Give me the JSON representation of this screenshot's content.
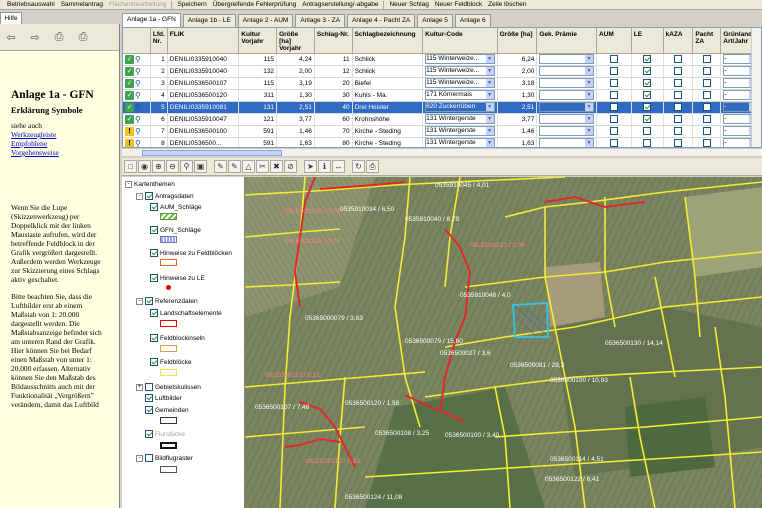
{
  "menu": {
    "items": [
      "Betriebsauswahl",
      "Sammelantrag",
      "Flächenbearbeitung",
      "Speichern",
      "Übergreifende Fehlerprüfung",
      "Antragserstellung/-abgabe",
      "Neuer Schlag",
      "Neuer Feldblock",
      "Zeile löschen"
    ]
  },
  "help": {
    "tab": "Hilfe",
    "title": "Anlage 1a - GFN",
    "subtitle": "Erklärung Symbole",
    "see_also": "siehe auch",
    "links": [
      "Werkzeugleiste",
      "Empfohlene",
      "Vorgehensweise"
    ],
    "para1": "Wenn Sie die Lupe (Skizzenwerkzeug) per Doppelklick mit der linken Maustaste aufrufen, wird der betreffende Feldblock in der Grafik vergrößert dargestellt. Außerdem werden Werkzeuge zur Skizzierung eines Schlags aktiv geschaltet.",
    "para2": "Bitte beachten Sie, dass die Luftbilder erst ab einem Maßstab von 1: 20.000 dargestellt werden. Die Maßstabsanzeige befindet sich am unteren Rand der Grafik. Hier können Sie bei Bedarf einen Maßstab von unter 1: 20.000 erfassen. Alternativ können Sie den Maßstab des Bildausschnitts auch mit der Funktionalität „Vergrößern\" verändern, damit das Luftbild"
  },
  "tabs": [
    "Anlage 1a - GFN",
    "Anlage 1b - LE",
    "Anlage 2 - AUM",
    "Anlage 3 - ZA",
    "Anlage 4 - Pacht ZA",
    "Anlage 5",
    "Anlage 6"
  ],
  "grid": {
    "headers": [
      "",
      "Lfd. Nr.",
      "FLIK",
      "Kultur Vorjahr",
      "Größe [ha] Vorjahr",
      "Schlag-Nr.",
      "Schlagbezeichnung",
      "Kultur-Code",
      "Größe [ha]",
      "Gek. Prämie",
      "AUM",
      "LE",
      "kAZA",
      "Pacht ZA",
      "Grünland Art/Jahr"
    ],
    "rows": [
      {
        "status": "ok",
        "nr": "1",
        "flik": "DENILI0335910040",
        "kv": "115",
        "gv": "4,24",
        "sn": "11",
        "name": "Schlick",
        "code": "115 Winterweize...",
        "g": "6,24",
        "aum": false,
        "le": true,
        "gr": "-"
      },
      {
        "status": "ok",
        "nr": "2",
        "flik": "DENILI0335910040",
        "kv": "132",
        "gv": "2,00",
        "sn": "12",
        "name": "Schlick",
        "code": "115 Winterweize...",
        "g": "2,00",
        "aum": false,
        "le": true,
        "gr": "-"
      },
      {
        "status": "ok",
        "nr": "3",
        "flik": "DENILI0536500107",
        "kv": "115",
        "gv": "3,19",
        "sn": "20",
        "name": "Biefel",
        "code": "115 Winterweize...",
        "g": "3,18",
        "aum": false,
        "le": true,
        "gr": "-"
      },
      {
        "status": "ok",
        "nr": "4",
        "flik": "DENILI0536500120",
        "kv": "311",
        "gv": "1,30",
        "sn": "30",
        "name": "Kuhls - Ma.",
        "code": "171 Körnermais",
        "g": "1,30",
        "aum": false,
        "le": true,
        "gr": "-"
      },
      {
        "status": "ok",
        "nr": "5",
        "flik": "DENILI0335910081",
        "kv": "131",
        "gv": "2,51",
        "sn": "40",
        "name": "Drei Heister",
        "code": "620 Zuckerrüben",
        "g": "2,51",
        "aum": false,
        "le": true,
        "gr": "-",
        "sel": true
      },
      {
        "status": "ok",
        "nr": "6",
        "flik": "DENILI0535910047",
        "kv": "121",
        "gv": "3,77",
        "sn": "60",
        "name": "Krohnshöhe",
        "code": "131 Wintergerste",
        "g": "3,77",
        "aum": false,
        "le": true,
        "gr": "-"
      },
      {
        "status": "warn",
        "nr": "7",
        "flik": "DENILI0536500100",
        "kv": "591",
        "gv": "1,46",
        "sn": "70",
        "name": "Kirche - Steding",
        "code": "131 Wintergerste",
        "g": "1,46",
        "aum": false,
        "le": false,
        "gr": "-"
      },
      {
        "status": "warn",
        "nr": "8",
        "flik": "DENILI0536500...",
        "kv": "591",
        "gv": "1,63",
        "sn": "80",
        "name": "Kirche - Steding",
        "code": "131 Wintergerste",
        "g": "1,63",
        "aum": false,
        "le": false,
        "gr": "-"
      }
    ]
  },
  "layers": {
    "root": "Kartenthemen",
    "antragsdaten": "Antragsdaten",
    "aum": "AUM_Schläge",
    "gfn": "GFN_Schläge",
    "hin_fb": "Hinweise zu Feldblöcken",
    "hin_le": "Hinweise zu LE",
    "ref": "Referenzdaten",
    "land": "Landschaftselemente",
    "fbi": "Feldblockinseln",
    "fb": "Feldblöcke",
    "geb": "Gebietskulissen",
    "luft": "Luftbilder",
    "gem": "Gemeinden",
    "grau": "Flurstücke",
    "bild": "Bildflugraster"
  },
  "map": {
    "labels": [
      {
        "t": "0535910045 / 4,01",
        "r": false
      },
      {
        "t": "0535910034 / 6,50",
        "r": false
      },
      {
        "t": "08LE029210 / 0,05",
        "r": true
      },
      {
        "t": "08LE029210 / 0,04",
        "r": true
      },
      {
        "t": "0535910040 / 8,79",
        "r": false
      },
      {
        "t": "08LE029210 / 0,08",
        "r": true
      },
      {
        "t": "0535910048 / 4,0",
        "r": false
      },
      {
        "t": "05365000079 / 3,83",
        "r": false
      },
      {
        "t": "0536500079 / 15,60",
        "r": false
      },
      {
        "t": "0536500027 / 3,6",
        "r": false
      },
      {
        "t": "0536500081 / 29,3",
        "r": false
      },
      {
        "t": "08LE029210 / 0,12",
        "r": true
      },
      {
        "t": "0536500107 / 7,48",
        "r": false
      },
      {
        "t": "0536500120 / 1,58",
        "r": false
      },
      {
        "t": "0536500100 / 10,93",
        "r": false
      },
      {
        "t": "0536500108 / 3,25",
        "r": false
      },
      {
        "t": "0536500100 / 3,40",
        "r": false
      },
      {
        "t": "08LE029210 / 0,03",
        "r": true
      },
      {
        "t": "0536500122 / 6,41",
        "r": false
      },
      {
        "t": "0536500124 / 11,08",
        "r": false
      },
      {
        "t": "0536500114 / 4,51",
        "r": false
      },
      {
        "t": "0536500130 / 14,14",
        "r": false
      }
    ]
  }
}
